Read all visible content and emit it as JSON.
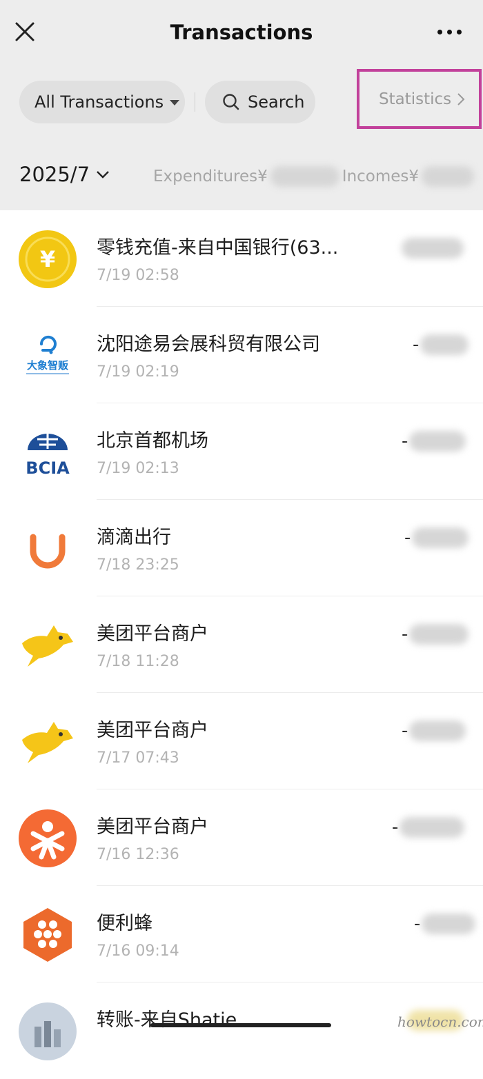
{
  "header": {
    "title": "Transactions",
    "close_icon": "close-icon",
    "more_icon": "more-icon"
  },
  "filters": {
    "all_label": "All Transactions",
    "search_label": "Search",
    "statistics_label": "Statistics"
  },
  "summary": {
    "month": "2025/7",
    "expenditures_label": "Expenditures¥",
    "incomes_label": "Incomes¥"
  },
  "colors": {
    "header_bg": "#ededed",
    "highlight_border": "#c2419b",
    "coin": "#f2c713",
    "didi": "#f07a3a",
    "meituan": "#f5c518",
    "dianping": "#f46a34",
    "bianlifeng": "#ec6a2c",
    "bcia": "#1e4f99"
  },
  "transactions": [
    {
      "name": "零钱充值-来自中国银行(63...",
      "time": "7/19 02:58",
      "icon": "coin-icon",
      "sign": ""
    },
    {
      "name": "沈阳途易会展科贸有限公司",
      "time": "7/19 02:19",
      "icon": "elephant-vending-logo",
      "sign": "-",
      "logo_text": "大象智贩"
    },
    {
      "name": "北京首都机场",
      "time": "7/19 02:13",
      "icon": "bcia-logo",
      "sign": "-",
      "logo_text": "BCIA"
    },
    {
      "name": "滴滴出行",
      "time": "7/18 23:25",
      "icon": "didi-logo",
      "sign": "-"
    },
    {
      "name": "美团平台商户",
      "time": "7/18 11:28",
      "icon": "meituan-kangaroo-logo",
      "sign": "-"
    },
    {
      "name": "美团平台商户",
      "time": "7/17 07:43",
      "icon": "meituan-kangaroo-logo",
      "sign": "-"
    },
    {
      "name": "美团平台商户",
      "time": "7/16 12:36",
      "icon": "dianping-logo",
      "sign": "-"
    },
    {
      "name": "便利蜂",
      "time": "7/16 09:14",
      "icon": "bianlifeng-logo",
      "sign": "-"
    },
    {
      "name": "转账-来自Shatie",
      "time": "",
      "icon": "avatar",
      "sign": ""
    }
  ],
  "watermark": "howtocn.com"
}
